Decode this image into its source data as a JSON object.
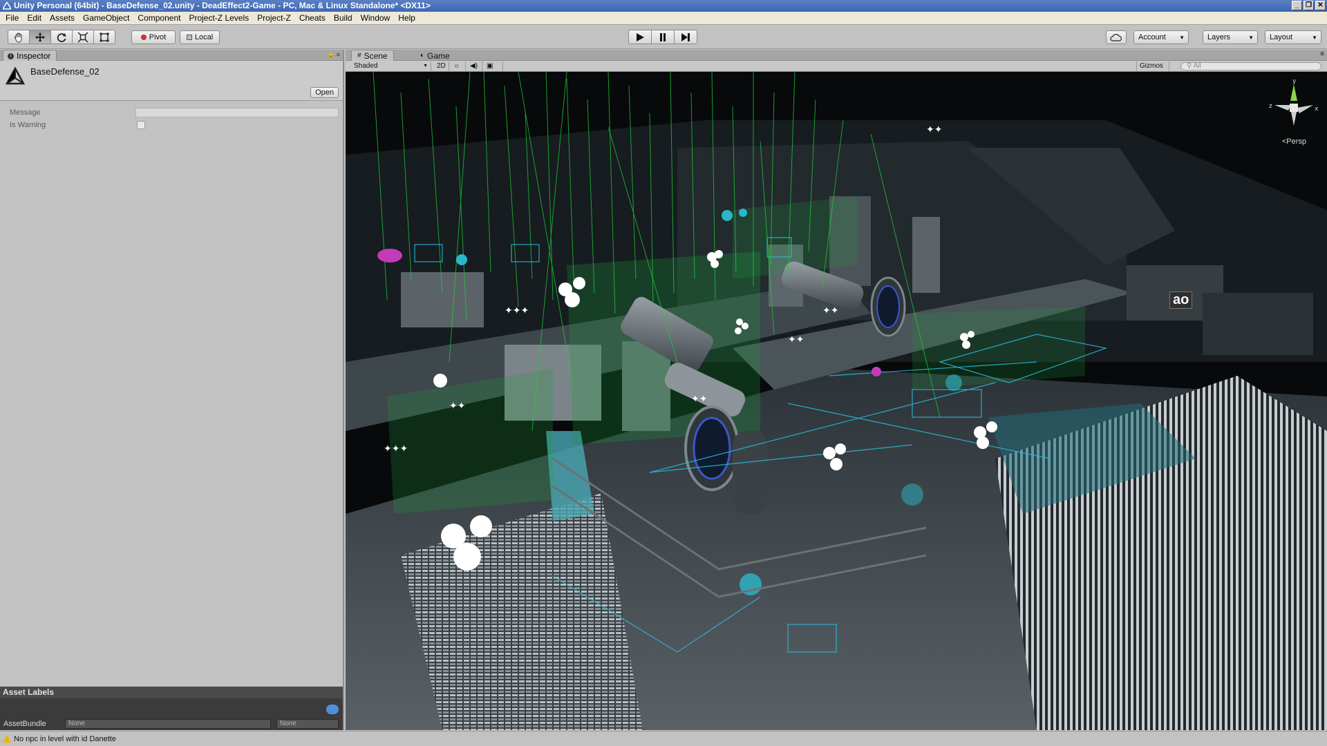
{
  "window": {
    "title": "Unity Personal (64bit) - BaseDefense_02.unity - DeadEffect2-Game - PC, Mac & Linux Standalone* <DX11>",
    "controls": [
      "_",
      "❐",
      "✕"
    ]
  },
  "menu": [
    "File",
    "Edit",
    "Assets",
    "GameObject",
    "Component",
    "Project-Z Levels",
    "Project-Z",
    "Cheats",
    "Build",
    "Window",
    "Help"
  ],
  "toolbar": {
    "pivot_label": "Pivot",
    "local_label": "Local",
    "account_label": "Account",
    "layers_label": "Layers",
    "layout_label": "Layout"
  },
  "inspector": {
    "tab_label": "Inspector",
    "title": "BaseDefense_02",
    "open_label": "Open",
    "fields": [
      {
        "label": "Message",
        "value": ""
      },
      {
        "label": "Is Warning",
        "checked": false
      }
    ]
  },
  "asset_labels": {
    "title": "Asset Labels",
    "bundle_label": "AssetBundle",
    "bundle_value": "None",
    "variant_value": "None"
  },
  "scene": {
    "tabs": [
      "Scene",
      "Game"
    ],
    "shading": "Shaded",
    "mode_2d": "2D",
    "gizmos_label": "Gizmos",
    "search_placeholder": "All",
    "overlay_text": "ao",
    "projection": "Persp",
    "axes": {
      "y": "y",
      "z": "z",
      "x": "x"
    }
  },
  "status": {
    "message": "No npc in level with id Danette",
    "warning_color": "#e6b800"
  }
}
